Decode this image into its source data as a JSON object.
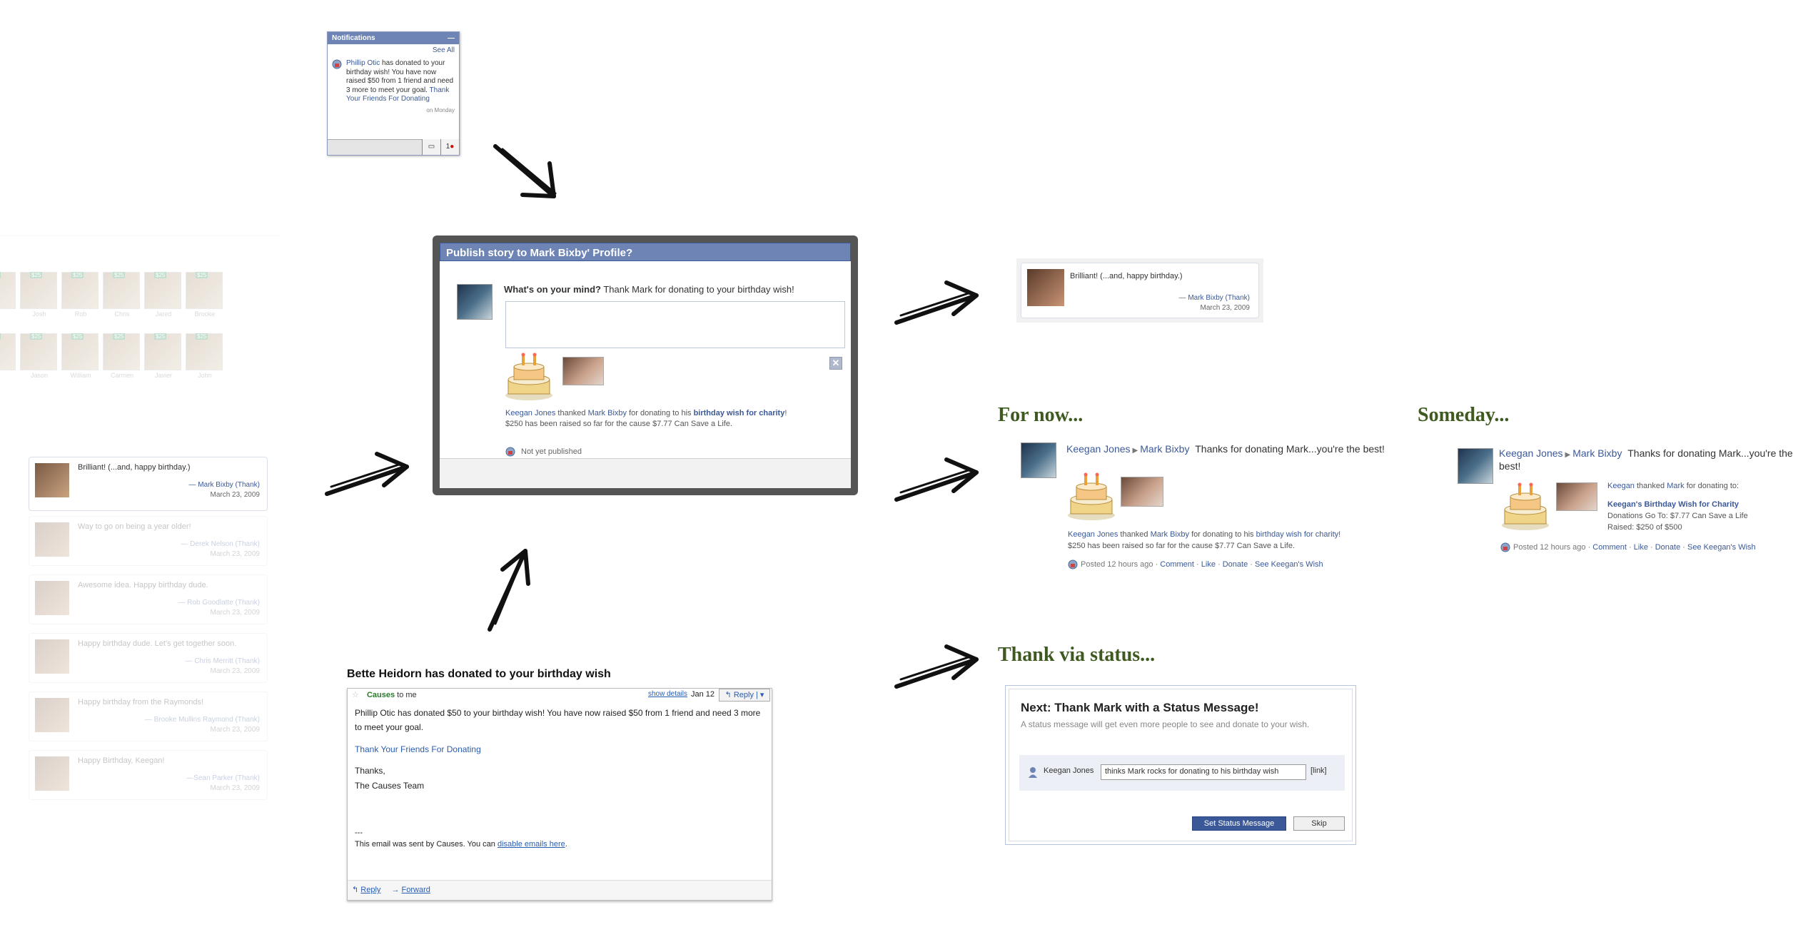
{
  "left_panel": {
    "friends": [
      {
        "amount": "$25",
        "name": "..."
      },
      {
        "amount": "$25",
        "name": "Josh"
      },
      {
        "amount": "$25",
        "name": "Rob"
      },
      {
        "amount": "$25",
        "name": "Chris"
      },
      {
        "amount": "$25",
        "name": "Jared"
      },
      {
        "amount": "$25",
        "name": "Brooke"
      },
      {
        "amount": "$25",
        "name": "..."
      },
      {
        "amount": "$25",
        "name": "Jason"
      },
      {
        "amount": "$25",
        "name": "William"
      },
      {
        "amount": "$25",
        "name": "Carmen"
      },
      {
        "amount": "$25",
        "name": "Javier"
      },
      {
        "amount": "$25",
        "name": "John"
      }
    ],
    "wall_posts": [
      {
        "text": "Brilliant! (...and, happy birthday.)",
        "author": "— Mark Bixby (Thank)",
        "date": "March 23, 2009"
      },
      {
        "text": "Way to go on being a year older!",
        "author": "— Derek Nelson (Thank)",
        "date": "March 23, 2009"
      },
      {
        "text": "Awesome idea. Happy birthday dude.",
        "author": "— Rob Goodlatte (Thank)",
        "date": "March 23, 2009"
      },
      {
        "text": "Happy birthday dude. Let's get together soon.",
        "author": "— Chris Merritt (Thank)",
        "date": "March 23, 2009"
      },
      {
        "text": "Happy birthday from the Raymonds!",
        "author": "— Brooke Mullins Raymond (Thank)",
        "date": "March 23, 2009"
      },
      {
        "text": "Happy Birthday, Keegan!",
        "author": "—Sean Parker (Thank)",
        "date": "March 23, 2009"
      }
    ]
  },
  "notifications": {
    "title": "Notifications",
    "minimize": "—",
    "see_all": "See All",
    "sender": "Phillip Otic",
    "message": " has donated to your birthday wish! You have now raised $50 from 1 friend and need 3 more to meet your goal. ",
    "link": "Thank Your Friends For Donating",
    "time": "on Monday",
    "count": "1"
  },
  "publish_dialog": {
    "title": "Publish story to Mark Bixby' Profile?",
    "prompt_bold": "What's on your mind?",
    "prompt_text": " Thank Mark for donating to your birthday wish!",
    "close": "✕",
    "story_actor": "Keegan Jones",
    "story_verb": " thanked ",
    "story_target": "Mark Bixby",
    "story_mid": " for donating to his ",
    "story_link": "birthday wish for charity",
    "story_end": "!",
    "story_line2": "$250 has been raised so far for the cause $7.77 Can Save a Life.",
    "not_published": "Not yet published"
  },
  "email": {
    "title": "Bette Heidorn has donated to your birthday wish",
    "from": "Causes",
    "to": " to me",
    "show_details": "show details",
    "date": "Jan 12",
    "reply_btn": "Reply",
    "body1": "Phillip Otic has donated $50 to your birthday wish! You have now raised $50 from 1 friend and need 3 more to meet your goal.",
    "body_link": "Thank Your Friends For Donating",
    "thanks": "Thanks,",
    "team": "The Causes Team",
    "sep": "---",
    "sent_by": "This email was sent by Causes. You can ",
    "disable": "disable emails here",
    "period": ".",
    "reply": "Reply",
    "forward": "Forward"
  },
  "brilliant_post": {
    "text": "Brilliant! (...and, happy birthday.)",
    "author_prefix": "— ",
    "author": "Mark Bixby",
    "thank": " (Thank)",
    "date": "March 23, 2009"
  },
  "for_now": {
    "heading": "For now...",
    "actor": "Keegan Jones",
    "target": "Mark Bixby",
    "message": "Thanks for donating Mark...you're the best!",
    "story_actor": "Keegan Jones",
    "story_verb": " thanked ",
    "story_target": "Mark Bixby",
    "story_mid": " for donating to his ",
    "story_link": "birthday wish for charity",
    "story_end": "!",
    "story_line2": "$250 has been raised so far for the cause $7.77 Can Save a Life.",
    "posted": "Posted 12 hours ago · ",
    "comment": "Comment",
    "like": "Like",
    "donate": "Donate",
    "see_wish": "See Keegan's Wish"
  },
  "someday": {
    "heading": "Someday...",
    "actor": "Keegan Jones",
    "target": "Mark Bixby",
    "message": "Thanks for donating Mark...you're the best!",
    "line_actor": "Keegan",
    "line_verb": " thanked ",
    "line_target": "Mark",
    "line_end": " for donating to:",
    "wish_title": "Keegan's Birthday Wish for Charity",
    "goes_to": "Donations Go To: $7.77 Can Save a Life",
    "raised": "Raised: $250 of $500",
    "posted": "Posted 12 hours ago · ",
    "comment": "Comment",
    "like": "Like",
    "donate": "Donate",
    "see_wish": "See Keegan's Wish"
  },
  "thank_status": {
    "heading": "Thank via status...",
    "title": "Next: Thank Mark with a Status Message!",
    "subtitle": "A status message will get even more people to see and donate to your wish.",
    "name": "Keegan Jones",
    "field": "thinks Mark rocks for donating to his birthday wish",
    "link": "[link]",
    "set_btn": "Set Status Message",
    "skip_btn": "Skip"
  },
  "colors": {
    "facebook_blue": "#3b5998",
    "header_blue": "#6d84b4",
    "heading_green": "#3f5a21"
  }
}
